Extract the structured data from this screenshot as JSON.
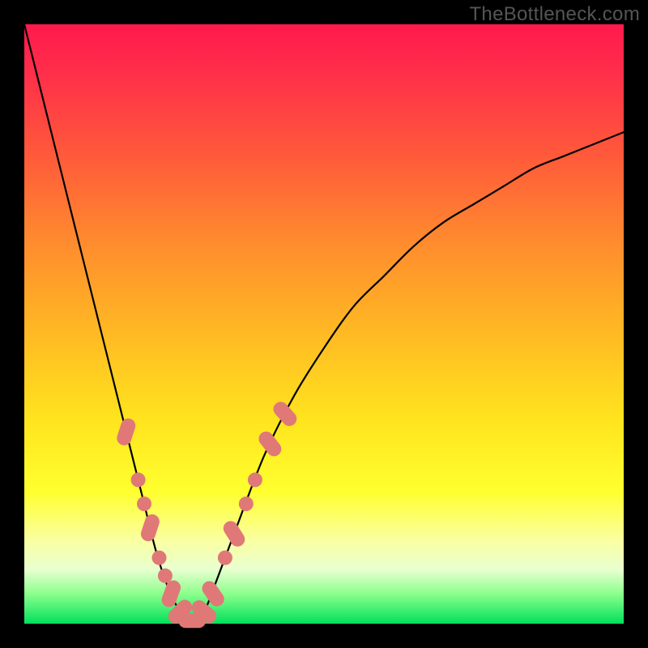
{
  "watermark": "TheBottleneck.com",
  "colors": {
    "frame": "#000000",
    "gradient_top": "#ff1a4d",
    "gradient_bottom": "#00e05c",
    "curve": "#000000",
    "marker": "#e07878"
  },
  "chart_data": {
    "type": "line",
    "title": "",
    "xlabel": "",
    "ylabel": "",
    "xlim": [
      0,
      100
    ],
    "ylim": [
      0,
      100
    ],
    "grid": false,
    "legend": false,
    "annotations": [
      "TheBottleneck.com"
    ],
    "series": [
      {
        "name": "bottleneck-curve",
        "x": [
          0,
          2,
          4,
          6,
          8,
          10,
          12,
          14,
          16,
          18,
          20,
          22,
          24,
          26,
          28,
          30,
          32,
          35,
          40,
          45,
          50,
          55,
          60,
          65,
          70,
          75,
          80,
          85,
          90,
          95,
          100
        ],
        "y": [
          100,
          92,
          84,
          76,
          68,
          60,
          52,
          44,
          36,
          28,
          20,
          12,
          6,
          2,
          0,
          2,
          7,
          15,
          28,
          38,
          46,
          53,
          58,
          63,
          67,
          70,
          73,
          76,
          78,
          80,
          82
        ]
      }
    ],
    "markers": [
      {
        "x": 17,
        "y": 32,
        "shape": "pill",
        "angle": -72
      },
      {
        "x": 19,
        "y": 24,
        "shape": "dot"
      },
      {
        "x": 20,
        "y": 20,
        "shape": "dot"
      },
      {
        "x": 21,
        "y": 16,
        "shape": "pill",
        "angle": -72
      },
      {
        "x": 22.5,
        "y": 11,
        "shape": "dot"
      },
      {
        "x": 23.5,
        "y": 8,
        "shape": "dot"
      },
      {
        "x": 24.5,
        "y": 5,
        "shape": "pill",
        "angle": -70
      },
      {
        "x": 26,
        "y": 2,
        "shape": "pill",
        "angle": -45
      },
      {
        "x": 28,
        "y": 0.5,
        "shape": "pill",
        "angle": 0
      },
      {
        "x": 30,
        "y": 2,
        "shape": "pill",
        "angle": 40
      },
      {
        "x": 31.5,
        "y": 5,
        "shape": "pill",
        "angle": 55
      },
      {
        "x": 33.5,
        "y": 11,
        "shape": "dot"
      },
      {
        "x": 35,
        "y": 15,
        "shape": "pill",
        "angle": 58
      },
      {
        "x": 37,
        "y": 20,
        "shape": "dot"
      },
      {
        "x": 38.5,
        "y": 24,
        "shape": "dot"
      },
      {
        "x": 41,
        "y": 30,
        "shape": "pill",
        "angle": 52
      },
      {
        "x": 43.5,
        "y": 35,
        "shape": "pill",
        "angle": 48
      }
    ]
  }
}
